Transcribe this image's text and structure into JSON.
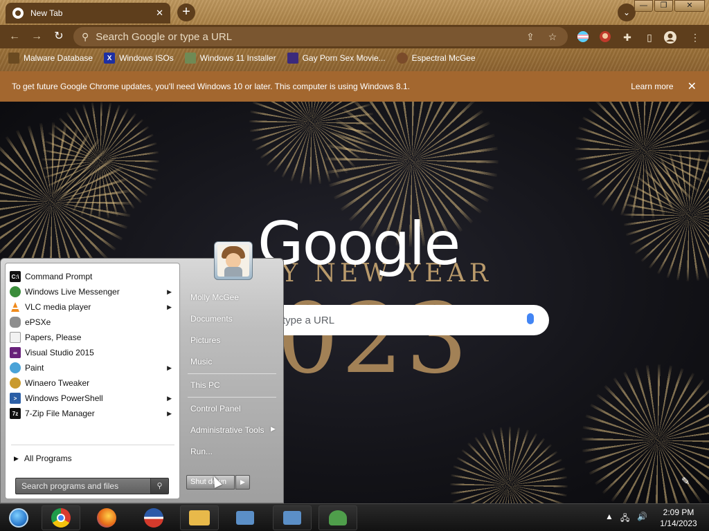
{
  "tab": {
    "title": "New Tab",
    "close": "✕"
  },
  "toolbar": {
    "omnibox_placeholder": "Search Google or type a URL"
  },
  "window_buttons": [
    "—",
    "❐",
    "✕"
  ],
  "bookmarks": [
    {
      "label": "Malware Database",
      "icon": "folder-icon",
      "color": "#6a4a21"
    },
    {
      "label": "Windows ISOs",
      "icon": "x-logo-icon",
      "color": "#1d2fa3"
    },
    {
      "label": "Windows 11 Installer",
      "icon": "image-icon",
      "color": "#6f8a55"
    },
    {
      "label": "Gay Porn Sex Movie...",
      "icon": "site-icon",
      "color": "#3b2a7c"
    },
    {
      "label": "Espectral McGee",
      "icon": "avatar-icon",
      "color": "#7a4b2a"
    }
  ],
  "infobar": {
    "message": "To get future Google Chrome updates, you'll need Windows 10 or later. This computer is using Windows 8.1.",
    "learn_more": "Learn more",
    "close": "✕"
  },
  "ntp": {
    "logo": "Google",
    "greeting": "PY NEW YEAR",
    "year": "023",
    "search_placeholder": "type a URL"
  },
  "start_menu": {
    "programs": [
      {
        "label": "Command Prompt",
        "icon": "cmd-icon",
        "color": "#111111",
        "arrow": false
      },
      {
        "label": "Windows Live Messenger",
        "icon": "messenger-icon",
        "color": "#3b8d3b",
        "arrow": true
      },
      {
        "label": "VLC media player",
        "icon": "vlc-icon",
        "color": "#f08b1d",
        "arrow": true
      },
      {
        "label": "ePSXe",
        "icon": "gamepad-icon",
        "color": "#6e6e6e",
        "arrow": false
      },
      {
        "label": "Papers, Please",
        "icon": "document-icon",
        "color": "#bdbdbd",
        "arrow": false
      },
      {
        "label": "Visual Studio 2015",
        "icon": "visual-studio-icon",
        "color": "#68217a",
        "arrow": false
      },
      {
        "label": "Paint",
        "icon": "paint-icon",
        "color": "#4aa3d8",
        "arrow": true
      },
      {
        "label": "Winaero Tweaker",
        "icon": "tweaker-icon",
        "color": "#c99a2e",
        "arrow": false
      },
      {
        "label": "Windows PowerShell",
        "icon": "powershell-icon",
        "color": "#2b5fa6",
        "arrow": true
      },
      {
        "label": "7-Zip File Manager",
        "icon": "7zip-icon",
        "color": "#111111",
        "arrow": true
      }
    ],
    "all_programs": "All Programs",
    "search_placeholder": "Search programs and files",
    "right_items": [
      {
        "label": "Molly McGee",
        "arrow": false
      },
      {
        "label": "Documents",
        "arrow": false
      },
      {
        "label": "Pictures",
        "arrow": false
      },
      {
        "label": "Music",
        "arrow": false
      },
      {
        "label": "This PC",
        "arrow": false
      },
      {
        "label": "Control Panel",
        "arrow": false
      },
      {
        "label": "Administrative Tools",
        "arrow": true
      },
      {
        "label": "Run...",
        "arrow": false
      }
    ],
    "shutdown": "Shut down"
  },
  "taskbar": {
    "apps": [
      {
        "name": "start-orb-icon",
        "color": "#2f7fd1"
      },
      {
        "name": "chrome-icon",
        "color": "#d93b2e"
      },
      {
        "name": "firefox-icon",
        "color": "#e66a17"
      },
      {
        "name": "obama-logo-icon",
        "color": "#2c5aa8"
      },
      {
        "name": "file-explorer-icon",
        "color": "#e8b94a"
      },
      {
        "name": "network-computer-icon",
        "color": "#5b8fc7"
      },
      {
        "name": "network-computer-icon",
        "color": "#5b8fc7"
      },
      {
        "name": "people-icon",
        "color": "#4f9e4b"
      }
    ],
    "time": "2:09 PM",
    "date": "1/14/2023"
  }
}
